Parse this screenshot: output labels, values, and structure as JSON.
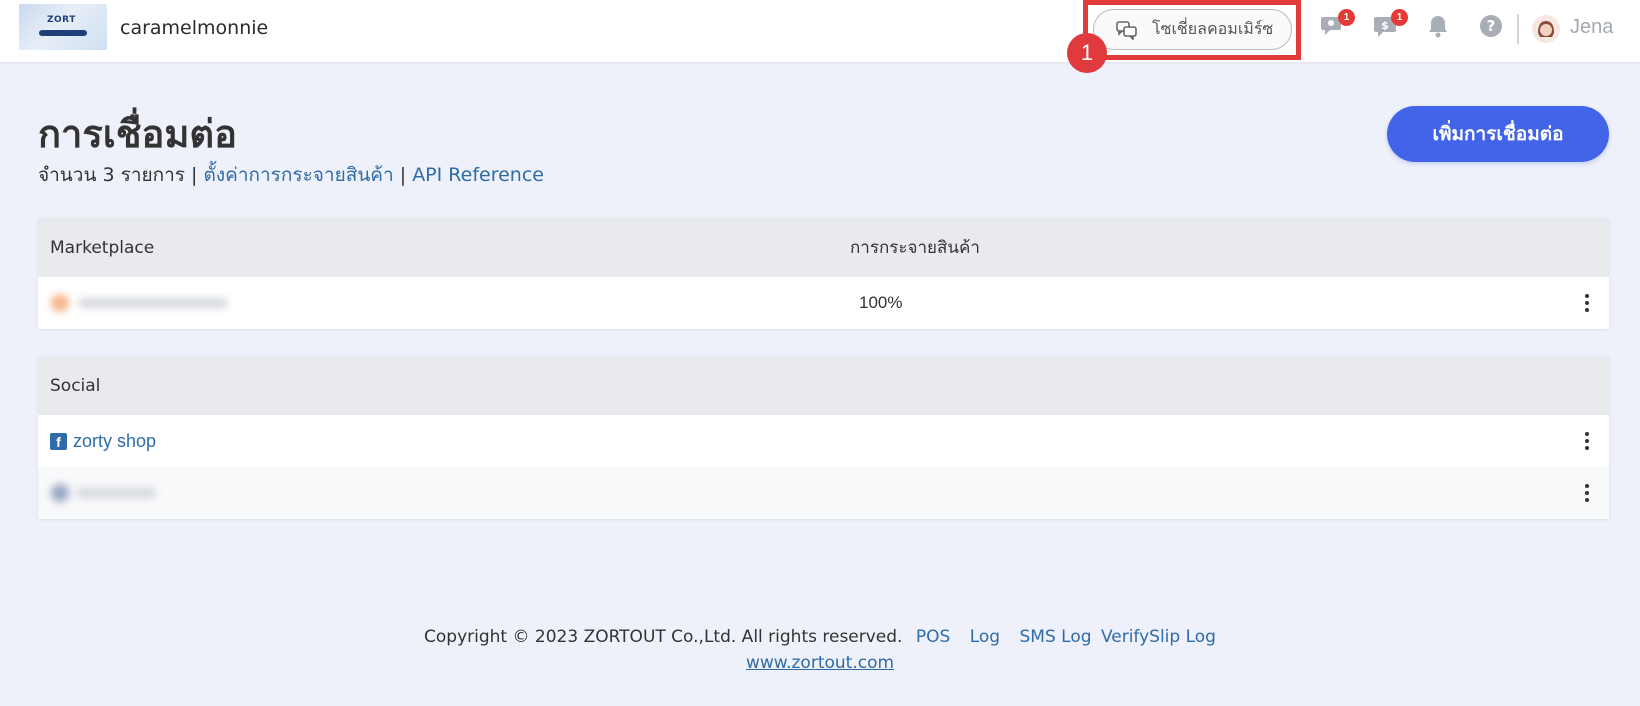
{
  "header": {
    "logo_text": "ZORT",
    "shop_name": "caramelmonnie",
    "social_commerce_label": "โซเชี่ยลคอมเมิร์ซ",
    "step_marker": "1",
    "notifications": [
      {
        "icon": "location-chat-icon",
        "count": "1"
      },
      {
        "icon": "payment-chat-icon",
        "count": "1"
      },
      {
        "icon": "bell-icon",
        "count": ""
      },
      {
        "icon": "help-icon",
        "count": ""
      }
    ],
    "user_name": "Jena"
  },
  "page": {
    "title": "การเชื่อมต่อ",
    "count_text": "จำนวน 3 รายการ",
    "separator": "|",
    "distribution_link": "ตั้งค่าการกระจายสินค้า",
    "api_link": "API Reference",
    "add_button": "เพิ่มการเชื่อมต่อ"
  },
  "marketplace_table": {
    "columns": [
      "Marketplace",
      "การกระจายสินค้า"
    ],
    "rows": [
      {
        "name": "",
        "distribution": "100%"
      }
    ]
  },
  "social_table": {
    "columns": [
      "Social"
    ],
    "rows": [
      {
        "name": "zorty shop",
        "icon": "facebook-icon"
      },
      {
        "name": "",
        "icon": ""
      }
    ]
  },
  "footer": {
    "copyright": "Copyright © 2023 ZORTOUT Co.,Ltd. All rights reserved.",
    "links": [
      "POS",
      "Log",
      "SMS Log",
      "VerifySlip Log"
    ],
    "website": "www.zortout.com"
  },
  "colors": {
    "accent": "#4264e8",
    "link": "#2f6ba8",
    "highlight": "#e03a3a",
    "badge": "#e53935"
  }
}
